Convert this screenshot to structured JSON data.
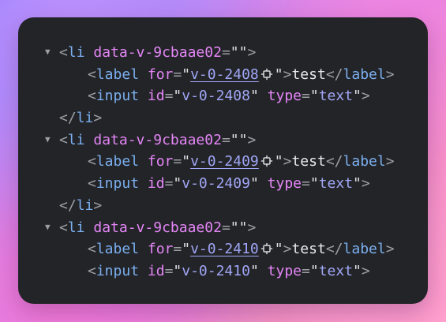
{
  "elements_panel": {
    "items": [
      {
        "li_open": {
          "tag": "li",
          "attr": "data-v-9cbaae02",
          "value": ""
        },
        "label": {
          "tag": "label",
          "attr": "for",
          "value": "v-0-2408",
          "text": "test"
        },
        "input": {
          "tag": "input",
          "id_attr": "id",
          "id_value": "v-0-2408",
          "type_attr": "type",
          "type_value": "text"
        },
        "li_close": {
          "tag": "li"
        }
      },
      {
        "li_open": {
          "tag": "li",
          "attr": "data-v-9cbaae02",
          "value": ""
        },
        "label": {
          "tag": "label",
          "attr": "for",
          "value": "v-0-2409",
          "text": "test"
        },
        "input": {
          "tag": "input",
          "id_attr": "id",
          "id_value": "v-0-2409",
          "type_attr": "type",
          "type_value": "text"
        },
        "li_close": {
          "tag": "li"
        }
      },
      {
        "li_open": {
          "tag": "li",
          "attr": "data-v-9cbaae02",
          "value": ""
        },
        "label": {
          "tag": "label",
          "attr": "for",
          "value": "v-0-2410",
          "text": "test"
        },
        "input": {
          "tag": "input",
          "id_attr": "id",
          "id_value": "v-0-2410",
          "type_attr": "type",
          "type_value": "text"
        }
      }
    ]
  },
  "icons": {
    "toggle": "disclosure-triangle-icon",
    "reveal": "reveal-node-icon"
  },
  "colors": {
    "panel_background": "#232428",
    "tag": "#7bb0f0",
    "attribute": "#e486f6",
    "value": "#a0a6f5",
    "text": "#e8eaed",
    "punctuation": "#9aa0a6"
  }
}
